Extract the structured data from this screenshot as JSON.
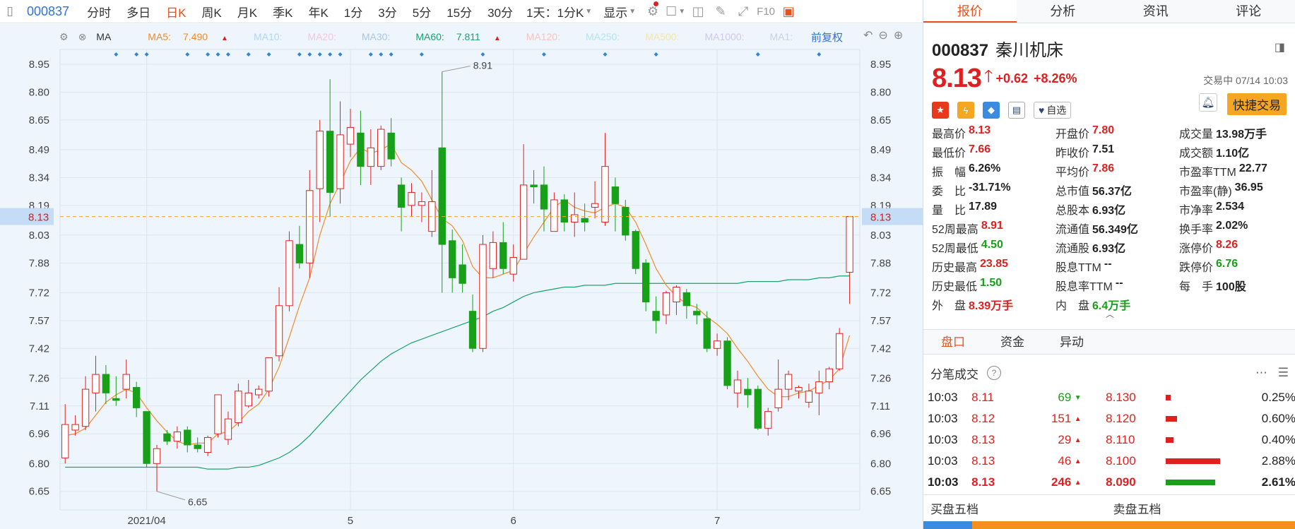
{
  "toolbar": {
    "code": "000837",
    "periods": [
      "分时",
      "多日",
      "日K",
      "周K",
      "月K",
      "季K",
      "年K",
      "1分",
      "3分",
      "5分",
      "15分",
      "30分"
    ],
    "active_period": "日K",
    "range_select": "1天：1分K",
    "display_select": "显示"
  },
  "ma_bar": {
    "items": [
      {
        "label": "MA",
        "value": "",
        "color": "#333333"
      },
      {
        "label": "MA5:",
        "value": "7.490",
        "color": "#f08c2a"
      },
      {
        "label": "MA10:",
        "value": "",
        "color": "#b5d6f5"
      },
      {
        "label": "MA20:",
        "value": "",
        "color": "#f5c6da"
      },
      {
        "label": "MA30:",
        "value": "",
        "color": "#a9c7e6"
      },
      {
        "label": "MA60:",
        "value": "7.811",
        "color": "#1aa36b"
      },
      {
        "label": "MA120:",
        "value": "",
        "color": "#f5c3c3"
      },
      {
        "label": "MA250:",
        "value": "",
        "color": "#b3e4f5"
      },
      {
        "label": "MA500:",
        "value": "",
        "color": "#f5e6a6"
      },
      {
        "label": "MA1000:",
        "value": "",
        "color": "#d2c6f0"
      },
      {
        "label": "MA1:",
        "value": "",
        "color": "#c6d2e6"
      }
    ],
    "fq": "前复权"
  },
  "chart_data": {
    "type": "candlestick",
    "y_ticks": [
      "8.95",
      "8.80",
      "8.65",
      "8.49",
      "8.34",
      "8.19",
      "8.03",
      "7.88",
      "7.72",
      "7.57",
      "7.42",
      "7.26",
      "7.11",
      "6.96",
      "6.80",
      "6.65"
    ],
    "ylim": [
      6.55,
      9.03
    ],
    "x_labels": [
      {
        "label": "2021/04",
        "i": 8
      },
      {
        "label": "5",
        "i": 28
      },
      {
        "label": "6",
        "i": 44
      },
      {
        "label": "7",
        "i": 64
      }
    ],
    "current_price_label": "8.13",
    "current_price": 8.13,
    "max_label": "8.91",
    "min_label": "6.65",
    "ohlc": [
      [
        6.83,
        7.01,
        6.8,
        7.12
      ],
      [
        6.98,
        7.01,
        6.95,
        7.06
      ],
      [
        7.0,
        7.2,
        6.98,
        7.27
      ],
      [
        7.18,
        7.28,
        7.08,
        7.38
      ],
      [
        7.28,
        7.18,
        7.12,
        7.33
      ],
      [
        7.15,
        7.14,
        7.11,
        7.27
      ],
      [
        7.2,
        7.28,
        7.15,
        7.36
      ],
      [
        7.21,
        7.1,
        7.05,
        7.24
      ],
      [
        7.08,
        6.8,
        6.78,
        7.08
      ],
      [
        6.8,
        6.88,
        6.65,
        6.9
      ],
      [
        6.96,
        6.92,
        6.9,
        6.98
      ],
      [
        6.92,
        6.97,
        6.88,
        7.0
      ],
      [
        6.98,
        6.9,
        6.86,
        7.0
      ],
      [
        6.9,
        6.88,
        6.86,
        6.94
      ],
      [
        6.86,
        6.94,
        6.84,
        6.95
      ],
      [
        6.96,
        7.17,
        6.94,
        7.17
      ],
      [
        6.93,
        7.04,
        6.9,
        7.08
      ],
      [
        7.02,
        7.19,
        7.0,
        7.23
      ],
      [
        7.11,
        7.18,
        7.1,
        7.25
      ],
      [
        7.17,
        7.2,
        7.15,
        7.22
      ],
      [
        7.19,
        7.37,
        7.16,
        7.37
      ],
      [
        7.38,
        7.65,
        7.35,
        7.75
      ],
      [
        7.65,
        8.0,
        7.62,
        8.05
      ],
      [
        7.98,
        7.88,
        7.85,
        8.08
      ],
      [
        7.88,
        8.27,
        7.8,
        8.38
      ],
      [
        8.28,
        8.59,
        8.1,
        8.65
      ],
      [
        8.59,
        8.26,
        8.13,
        8.87
      ],
      [
        8.28,
        8.57,
        8.2,
        8.75
      ],
      [
        8.52,
        8.61,
        8.45,
        8.71
      ],
      [
        8.58,
        8.4,
        8.3,
        8.7
      ],
      [
        8.4,
        8.5,
        8.3,
        8.6
      ],
      [
        8.4,
        8.6,
        8.38,
        8.62
      ],
      [
        8.58,
        8.44,
        8.4,
        8.66
      ],
      [
        8.3,
        8.18,
        8.05,
        8.34
      ],
      [
        8.19,
        8.26,
        8.13,
        8.31
      ],
      [
        8.19,
        8.21,
        8.1,
        8.26
      ],
      [
        8.05,
        8.21,
        8.02,
        8.38
      ],
      [
        8.5,
        7.98,
        7.72,
        8.91
      ],
      [
        8.0,
        7.8,
        7.72,
        8.06
      ],
      [
        7.87,
        7.77,
        7.72,
        7.98
      ],
      [
        7.62,
        7.42,
        7.4,
        7.71
      ],
      [
        7.42,
        7.98,
        7.4,
        8.03
      ],
      [
        7.85,
        7.99,
        7.8,
        8.05
      ],
      [
        7.99,
        7.85,
        7.82,
        8.1
      ],
      [
        7.82,
        7.91,
        7.78,
        7.98
      ],
      [
        7.9,
        8.3,
        7.9,
        8.52
      ],
      [
        8.3,
        8.29,
        8.2,
        8.38
      ],
      [
        8.3,
        8.17,
        8.05,
        8.4
      ],
      [
        8.05,
        8.22,
        8.05,
        8.26
      ],
      [
        8.22,
        8.1,
        8.05,
        8.25
      ],
      [
        8.1,
        8.14,
        8.02,
        8.26
      ],
      [
        8.12,
        8.1,
        8.05,
        8.2
      ],
      [
        8.18,
        8.2,
        8.12,
        8.32
      ],
      [
        8.1,
        8.4,
        8.08,
        8.58
      ],
      [
        8.29,
        8.2,
        8.05,
        8.34
      ],
      [
        8.18,
        8.03,
        8.0,
        8.22
      ],
      [
        8.05,
        7.85,
        7.82,
        8.06
      ],
      [
        7.88,
        7.67,
        7.62,
        7.9
      ],
      [
        7.62,
        7.57,
        7.5,
        7.7
      ],
      [
        7.6,
        7.72,
        7.55,
        7.73
      ],
      [
        7.67,
        7.75,
        7.6,
        7.76
      ],
      [
        7.72,
        7.65,
        7.58,
        7.74
      ],
      [
        7.62,
        7.6,
        7.55,
        7.66
      ],
      [
        7.58,
        7.42,
        7.4,
        7.62
      ],
      [
        7.42,
        7.46,
        7.38,
        7.5
      ],
      [
        7.46,
        7.22,
        7.2,
        7.48
      ],
      [
        7.18,
        7.25,
        7.1,
        7.3
      ],
      [
        7.2,
        7.17,
        7.1,
        7.26
      ],
      [
        7.2,
        6.99,
        6.98,
        7.22
      ],
      [
        6.99,
        7.08,
        6.95,
        7.1
      ],
      [
        7.1,
        7.2,
        7.08,
        7.36
      ],
      [
        7.2,
        7.28,
        7.14,
        7.3
      ],
      [
        7.19,
        7.21,
        7.15,
        7.22
      ],
      [
        7.13,
        7.19,
        7.1,
        7.23
      ],
      [
        7.18,
        7.24,
        7.06,
        7.3
      ],
      [
        7.24,
        7.31,
        7.2,
        7.32
      ],
      [
        7.31,
        7.5,
        7.3,
        7.53
      ],
      [
        7.83,
        8.13,
        7.66,
        8.13
      ]
    ],
    "ma5": [
      6.95,
      6.96,
      6.99,
      7.06,
      7.13,
      7.17,
      7.2,
      7.18,
      7.1,
      7.03,
      6.97,
      6.92,
      6.9,
      6.91,
      6.91,
      6.96,
      6.97,
      7.02,
      7.08,
      7.12,
      7.2,
      7.32,
      7.48,
      7.65,
      7.8,
      8.03,
      8.2,
      8.31,
      8.43,
      8.5,
      8.47,
      8.49,
      8.52,
      8.42,
      8.38,
      8.32,
      8.22,
      8.12,
      8.08,
      8.0,
      7.86,
      7.8,
      7.8,
      7.82,
      7.84,
      7.93,
      8.02,
      8.1,
      8.18,
      8.22,
      8.18,
      8.16,
      8.15,
      8.18,
      8.2,
      8.18,
      8.1,
      7.98,
      7.85,
      7.76,
      7.7,
      7.66,
      7.64,
      7.59,
      7.55,
      7.5,
      7.42,
      7.35,
      7.27,
      7.2,
      7.16,
      7.16,
      7.18,
      7.19,
      7.22,
      7.25,
      7.31,
      7.49
    ],
    "ma60": [
      6.78,
      6.78,
      6.78,
      6.78,
      6.78,
      6.78,
      6.78,
      6.78,
      6.78,
      6.78,
      6.78,
      6.78,
      6.78,
      6.78,
      6.77,
      6.77,
      6.77,
      6.78,
      6.78,
      6.79,
      6.81,
      6.83,
      6.86,
      6.9,
      6.95,
      7.01,
      7.07,
      7.13,
      7.19,
      7.25,
      7.3,
      7.35,
      7.39,
      7.42,
      7.45,
      7.47,
      7.49,
      7.51,
      7.53,
      7.55,
      7.57,
      7.59,
      7.62,
      7.64,
      7.67,
      7.7,
      7.72,
      7.73,
      7.74,
      7.75,
      7.75,
      7.76,
      7.76,
      7.76,
      7.77,
      7.77,
      7.77,
      7.77,
      7.77,
      7.77,
      7.77,
      7.77,
      7.77,
      7.77,
      7.77,
      7.77,
      7.77,
      7.78,
      7.78,
      7.78,
      7.78,
      7.79,
      7.79,
      7.79,
      7.8,
      7.8,
      7.81,
      7.81
    ]
  },
  "tabs": [
    "报价",
    "分析",
    "资讯",
    "评论"
  ],
  "active_tab": "报价",
  "stock": {
    "code": "000837",
    "name": "秦川机床",
    "price": "8.13",
    "change": "+0.62",
    "change_pct": "+8.26%",
    "status": "交易中 07/14 10:03",
    "zixuan": "自选",
    "quick_trade": "快捷交易"
  },
  "quote_rows": [
    [
      {
        "l": "最高价",
        "v": "8.13",
        "c": "red"
      },
      {
        "l": "开盘价",
        "v": "7.80",
        "c": "red"
      },
      {
        "l": "成交量",
        "v": "13.98万手",
        "c": "blk"
      }
    ],
    [
      {
        "l": "最低价",
        "v": "7.66",
        "c": "red"
      },
      {
        "l": "昨收价",
        "v": "7.51",
        "c": "blk"
      },
      {
        "l": "成交额",
        "v": "1.10亿",
        "c": "blk"
      }
    ],
    [
      {
        "l": "振　幅",
        "v": "6.26%",
        "c": "blk"
      },
      {
        "l": "平均价",
        "v": "7.86",
        "c": "red"
      },
      {
        "l": "市盈率TTM",
        "v": "22.77",
        "c": "blk"
      }
    ],
    [
      {
        "l": "委　比",
        "v": "-31.71%",
        "c": "blk"
      },
      {
        "l": "总市值",
        "v": "56.37亿",
        "c": "blk"
      },
      {
        "l": "市盈率(静)",
        "v": "36.95",
        "c": "blk"
      }
    ],
    [
      {
        "l": "量　比",
        "v": "17.89",
        "c": "blk"
      },
      {
        "l": "总股本",
        "v": "6.93亿",
        "c": "blk"
      },
      {
        "l": "市净率",
        "v": "2.534",
        "c": "blk"
      }
    ],
    [
      {
        "l": "52周最高",
        "v": "8.91",
        "c": "red"
      },
      {
        "l": "流通值",
        "v": "56.349亿",
        "c": "blk"
      },
      {
        "l": "换手率",
        "v": "2.02%",
        "c": "blk"
      }
    ],
    [
      {
        "l": "52周最低",
        "v": "4.50",
        "c": "green"
      },
      {
        "l": "流通股",
        "v": "6.93亿",
        "c": "blk"
      },
      {
        "l": "涨停价",
        "v": "8.26",
        "c": "red"
      }
    ],
    [
      {
        "l": "历史最高",
        "v": "23.85",
        "c": "red"
      },
      {
        "l": "股息TTM",
        "v": "--",
        "c": "blk"
      },
      {
        "l": "跌停价",
        "v": "6.76",
        "c": "green"
      }
    ],
    [
      {
        "l": "历史最低",
        "v": "1.50",
        "c": "green"
      },
      {
        "l": "股息率TTM",
        "v": "--",
        "c": "blk"
      },
      {
        "l": "每　手",
        "v": "100股",
        "c": "blk"
      }
    ],
    [
      {
        "l": "外　盘",
        "v": "8.39万手",
        "c": "red"
      },
      {
        "l": "内　盘",
        "v": "6.4万手",
        "c": "green"
      },
      {
        "l": "",
        "v": "",
        "c": "blk"
      }
    ]
  ],
  "subtabs": [
    "盘口",
    "资金",
    "异动"
  ],
  "active_subtab": "盘口",
  "ticks_title": "分笔成交",
  "ticks": [
    {
      "time": "10:03",
      "price": "8.11",
      "vol": "69",
      "dir": "down",
      "bold": false
    },
    {
      "time": "10:03",
      "price": "8.12",
      "vol": "151",
      "dir": "up",
      "bold": false
    },
    {
      "time": "10:03",
      "price": "8.13",
      "vol": "29",
      "dir": "up",
      "bold": false
    },
    {
      "time": "10:03",
      "price": "8.13",
      "vol": "46",
      "dir": "up",
      "bold": false
    },
    {
      "time": "10:03",
      "price": "8.13",
      "vol": "246",
      "dir": "up",
      "bold": true
    }
  ],
  "levels": [
    {
      "price": "8.130",
      "pct": "0.25%",
      "fill": 0.0025,
      "color": "#e02020"
    },
    {
      "price": "8.120",
      "pct": "0.60%",
      "fill": 0.006,
      "color": "#e02020"
    },
    {
      "price": "8.110",
      "pct": "0.40%",
      "fill": 0.004,
      "color": "#e02020"
    },
    {
      "price": "8.100",
      "pct": "2.88%",
      "fill": 0.0288,
      "color": "#e02020"
    },
    {
      "price": "8.090",
      "pct": "2.61%",
      "fill": 0.0261,
      "color": "#18a018"
    }
  ],
  "bid_label": "买盘五档",
  "ask_label": "卖盘五档",
  "bid_ratio": 0.13
}
